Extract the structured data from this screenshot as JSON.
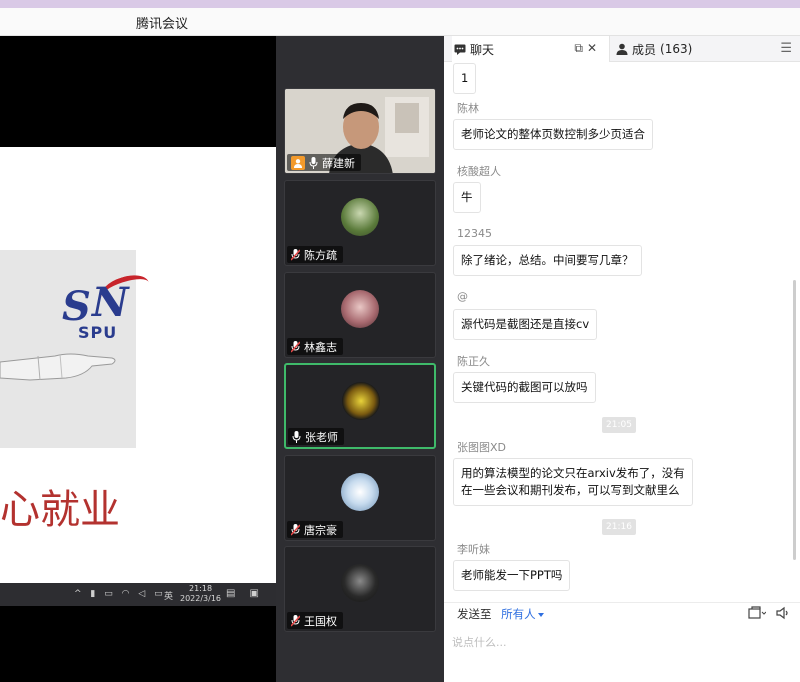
{
  "window": {
    "title": "腾讯会议"
  },
  "slide": {
    "logo_text": "SPU",
    "headline": "心就业"
  },
  "taskbar": {
    "time": "21:18",
    "date": "2022/3/16",
    "ime": "英"
  },
  "participants": [
    {
      "name": "薛建新",
      "role": "host",
      "mic": "on",
      "camera": true
    },
    {
      "name": "陈方疏",
      "mic": "muted",
      "avatar_color": "#7a9a5a"
    },
    {
      "name": "林鑫志",
      "mic": "muted",
      "avatar_color": "#b57a7f"
    },
    {
      "name": "张老师",
      "mic": "on",
      "avatar_color": "#6a5a2a",
      "active_speaker": true
    },
    {
      "name": "唐宗豪",
      "mic": "muted",
      "avatar_color": "#a9c9e3"
    },
    {
      "name": "王国权",
      "mic": "muted",
      "avatar_color": "#3a3a3a"
    }
  ],
  "tabs": {
    "chat_label": "聊天",
    "members_label": "成员",
    "members_count": "(163)"
  },
  "chat": {
    "messages": [
      {
        "sender": "",
        "text": "1"
      },
      {
        "sender": "陈林",
        "text": "老师论文的整体页数控制多少页适合"
      },
      {
        "sender": "核酸超人",
        "text": "牛"
      },
      {
        "sender": "12345",
        "text": "除了绪论，总结。中间要写几章？"
      },
      {
        "sender": "@",
        "text": "源代码是截图还是直接cv"
      },
      {
        "sender": "陈正久",
        "text": "关键代码的截图可以放吗"
      },
      {
        "timestamp": "21:05"
      },
      {
        "sender": "张图图XD",
        "lines": [
          "用的算法模型的论文只在arxiv发布了，没有",
          "在一些会议和期刊发布，可以写到文献里么"
        ]
      },
      {
        "timestamp": "21:16"
      },
      {
        "sender": "李听妹",
        "text": "老师能发一下PPT吗"
      }
    ]
  },
  "composer": {
    "send_to_label": "发送至",
    "send_to_target": "所有人",
    "placeholder": "说点什么..."
  }
}
